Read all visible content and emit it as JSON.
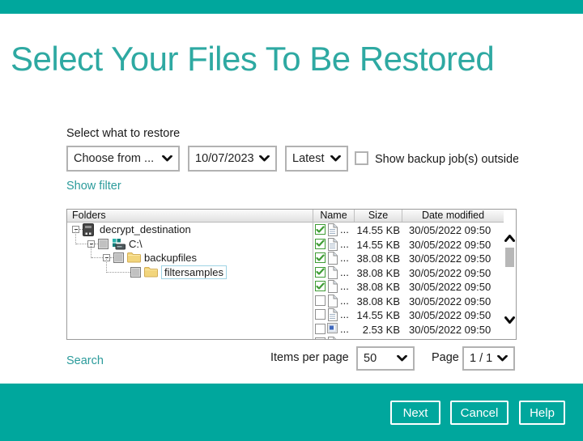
{
  "title": "Select Your Files To Be Restored",
  "restore_controls": {
    "label": "Select what to restore",
    "source_dropdown_value": "Choose from ...",
    "date_dropdown_value": "10/07/2023",
    "time_dropdown_value": "Latest",
    "show_outside_checkbox_label": "Show backup job(s) outside",
    "show_filter_link": "Show filter"
  },
  "folders_panel": {
    "header": "Folders",
    "tree": [
      {
        "label": "decrypt_destination",
        "level": 0,
        "icon": "device-icon",
        "expander": true,
        "checkbox": "none",
        "selected": false
      },
      {
        "label": "C:\\",
        "level": 1,
        "icon": "drive-icon",
        "expander": true,
        "checkbox": "partial",
        "selected": false
      },
      {
        "label": "backupfiles",
        "level": 2,
        "icon": "folder-icon",
        "expander": true,
        "checkbox": "partial",
        "selected": false
      },
      {
        "label": "filtersamples",
        "level": 3,
        "icon": "folder-icon",
        "expander": false,
        "checkbox": "partial",
        "selected": true
      }
    ]
  },
  "file_list": {
    "columns": [
      "Name",
      "Size",
      "Date modified"
    ],
    "rows": [
      {
        "checked": true,
        "icon": "doc-lines-icon",
        "name": "...",
        "size": "14.55 KB",
        "date": "30/05/2022 09:50"
      },
      {
        "checked": true,
        "icon": "doc-lines-icon",
        "name": "...",
        "size": "14.55 KB",
        "date": "30/05/2022 09:50"
      },
      {
        "checked": true,
        "icon": "doc-plain-icon",
        "name": "...",
        "size": "38.08 KB",
        "date": "30/05/2022 09:50"
      },
      {
        "checked": true,
        "icon": "doc-plain-icon",
        "name": "...",
        "size": "38.08 KB",
        "date": "30/05/2022 09:50"
      },
      {
        "checked": true,
        "icon": "doc-plain-icon",
        "name": "...",
        "size": "38.08 KB",
        "date": "30/05/2022 09:50"
      },
      {
        "checked": false,
        "icon": "doc-plain-icon",
        "name": "...",
        "size": "38.08 KB",
        "date": "30/05/2022 09:50"
      },
      {
        "checked": false,
        "icon": "doc-lines-icon",
        "name": "...",
        "size": "14.55 KB",
        "date": "30/05/2022 09:50"
      },
      {
        "checked": false,
        "icon": "image-file-icon",
        "name": "...",
        "size": "2.53 KB",
        "date": "30/05/2022 09:50"
      },
      {
        "checked": false,
        "icon": "doc-plain-icon",
        "name": "",
        "size": "",
        "date": "",
        "partial": true
      }
    ]
  },
  "pagination": {
    "search_link": "Search",
    "items_per_page_label": "Items per page",
    "items_per_page_value": "50",
    "page_label": "Page",
    "page_value": "1 / 1"
  },
  "footer": {
    "next_label": "Next",
    "cancel_label": "Cancel",
    "help_label": "Help"
  },
  "colors": {
    "teal_bar": "#00a79d",
    "title_teal": "#2ea9a2",
    "link_teal": "#2b9b9b",
    "check_green": "#3f9c35"
  }
}
